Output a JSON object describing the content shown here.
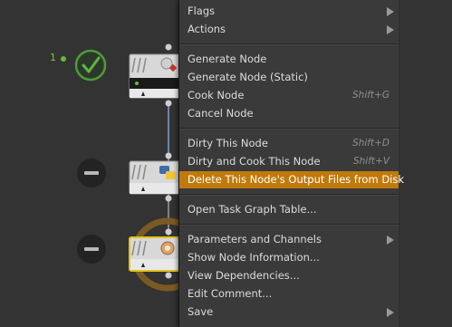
{
  "node_graph": {
    "nodes": [
      {
        "index_label": "1",
        "status": "cooked",
        "status_icon": "check-icon"
      },
      {
        "status": "idle",
        "status_icon": "minus-icon",
        "node_icon": "python-icon"
      },
      {
        "status": "selected",
        "status_icon": "minus-icon",
        "node_icon": "output-node-icon"
      }
    ]
  },
  "context_menu": {
    "items": [
      {
        "label": "Flags",
        "submenu": true
      },
      {
        "label": "Actions",
        "submenu": true
      },
      {
        "label": "Generate Node"
      },
      {
        "label": "Generate Node (Static)"
      },
      {
        "label": "Cook Node",
        "shortcut": "Shift+G"
      },
      {
        "label": "Cancel Node"
      },
      {
        "label": "Dirty This Node",
        "shortcut": "Shift+D"
      },
      {
        "label": "Dirty and Cook This Node",
        "shortcut": "Shift+V"
      },
      {
        "label": "Delete This Node's Output Files from Disk",
        "highlighted": true
      },
      {
        "label": "Open Task Graph Table..."
      },
      {
        "label": "Parameters and Channels",
        "submenu": true
      },
      {
        "label": "Show Node Information..."
      },
      {
        "label": "View Dependencies..."
      },
      {
        "label": "Edit Comment..."
      },
      {
        "label": "Save",
        "submenu": true
      }
    ]
  },
  "colors": {
    "background": "#333333",
    "menu_bg": "#3a3a3a",
    "highlight": "#c07a0c",
    "success_green": "#4f9a3a",
    "selected_ring": "#7a5a24",
    "selected_border": "#e6c21a",
    "wire": "#7fa0c8"
  }
}
